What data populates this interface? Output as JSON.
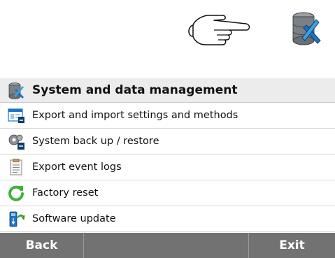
{
  "header": {
    "title": "System and data management",
    "icon": "database-tools-icon"
  },
  "top_icons": [
    "pointing-hand-icon",
    "database-tools-icon"
  ],
  "menu": [
    {
      "label": "Export and import settings and methods",
      "icon": "window-export-icon"
    },
    {
      "label": "System back up / restore",
      "icon": "gears-backup-icon"
    },
    {
      "label": "Export event logs",
      "icon": "clipboard-log-icon"
    },
    {
      "label": "Factory reset",
      "icon": "green-refresh-icon"
    },
    {
      "label": "Software update",
      "icon": "usb-update-icon"
    }
  ],
  "footer": {
    "back_label": "Back",
    "exit_label": "Exit"
  },
  "colors": {
    "footer_bg": "#727272",
    "header_bg": "#ececec",
    "accent_blue": "#1e73c8",
    "accent_green": "#3fb33b"
  }
}
